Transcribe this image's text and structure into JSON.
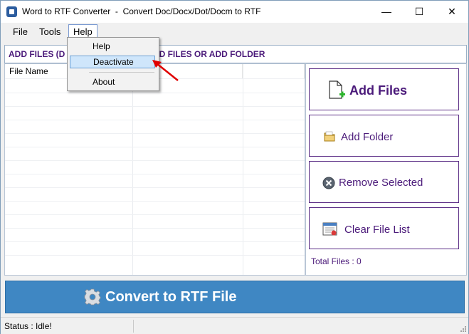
{
  "window": {
    "title": "Word to RTF Converter  -  Convert Doc/Docx/Dot/Docm to RTF",
    "minimize_glyph": "—",
    "maximize_glyph": "☐",
    "close_glyph": "✕"
  },
  "menubar": {
    "file": "File",
    "tools": "Tools",
    "help": "Help"
  },
  "help_menu": {
    "items": [
      "Help",
      "Deactivate",
      "About"
    ],
    "highlighted": "Deactivate"
  },
  "header": {
    "text": "ADD FILES (D                               N ADD FILES OR ADD FOLDER"
  },
  "file_table": {
    "columns": [
      "File Name",
      "",
      ""
    ],
    "rows": []
  },
  "actions": {
    "add_files": "Add Files",
    "add_folder": "Add Folder",
    "remove_selected": "Remove Selected",
    "clear_file_list": "Clear File List"
  },
  "total_files": "Total Files : 0",
  "convert_button": "Convert to RTF File",
  "status": "Status  :  Idle!",
  "colors": {
    "accent_purple": "#4b1a7a",
    "convert_blue": "#3f87c3",
    "highlight": "#cfe6fb",
    "arrow_red": "#e00000"
  },
  "icons": {
    "add_files": "document-plus-icon",
    "add_folder": "folder-icon",
    "remove_selected": "remove-icon",
    "clear_file_list": "clear-list-icon",
    "convert": "gear-icon"
  }
}
